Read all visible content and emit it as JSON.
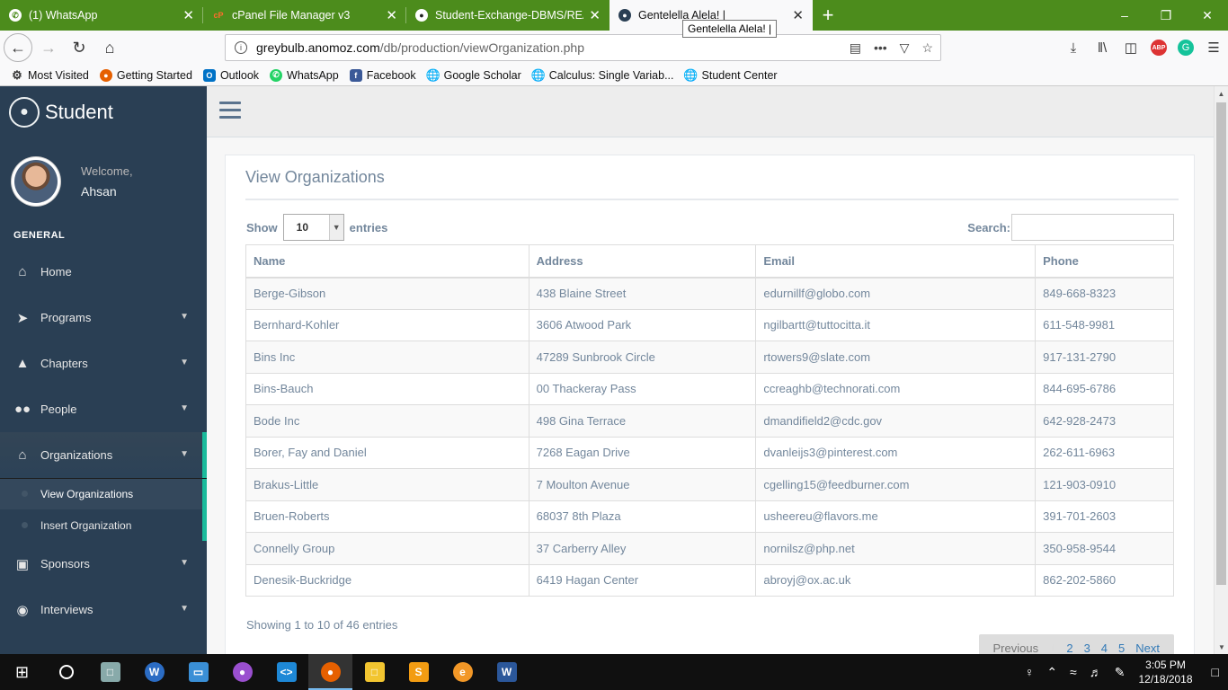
{
  "browser": {
    "tabs": [
      {
        "label": "(1) WhatsApp",
        "icon": "whatsapp-icon",
        "active": false
      },
      {
        "label": "cPanel File Manager v3",
        "icon": "cpanel-icon",
        "active": false
      },
      {
        "label": "Student-Exchange-DBMS/READ",
        "icon": "github-icon",
        "active": false
      },
      {
        "label": "Gentelella Alela! |",
        "icon": "paw-icon",
        "active": true
      }
    ],
    "tooltip": "Gentelella Alela! |",
    "url_host": "greybulb.anomoz.com",
    "url_path": "/db/production/viewOrganization.php",
    "bookmarks": [
      {
        "label": "Most Visited",
        "icon": "gear-icon"
      },
      {
        "label": "Getting Started",
        "icon": "firefox-icon"
      },
      {
        "label": "Outlook",
        "icon": "outlook-icon"
      },
      {
        "label": "WhatsApp",
        "icon": "whatsapp-icon"
      },
      {
        "label": "Facebook",
        "icon": "facebook-icon"
      },
      {
        "label": "Google Scholar",
        "icon": "globe-icon"
      },
      {
        "label": "Calculus: Single Variab...",
        "icon": "globe-icon"
      },
      {
        "label": "Student Center",
        "icon": "globe-icon"
      }
    ]
  },
  "sidebar": {
    "brand": "Student",
    "welcome": "Welcome,",
    "user": "Ahsan",
    "section": "GENERAL",
    "items": [
      {
        "label": "Home",
        "icon": "home-icon"
      },
      {
        "label": "Programs",
        "icon": "rocket-icon"
      },
      {
        "label": "Chapters",
        "icon": "graduation-cap-icon"
      },
      {
        "label": "People",
        "icon": "users-icon"
      },
      {
        "label": "Organizations",
        "icon": "bank-icon"
      },
      {
        "label": "Sponsors",
        "icon": "money-icon"
      },
      {
        "label": "Interviews",
        "icon": "comments-icon"
      }
    ],
    "submenu": [
      "View Organizations",
      "Insert Organization"
    ]
  },
  "main": {
    "title": "View Organizations",
    "show_label": "Show",
    "entries_label": "entries",
    "page_length": "10",
    "search_label": "Search:",
    "columns": [
      "Name",
      "Address",
      "Email",
      "Phone"
    ],
    "rows": [
      [
        "Berge-Gibson",
        "438 Blaine Street",
        "edurnillf@globo.com",
        "849-668-8323"
      ],
      [
        "Bernhard-Kohler",
        "3606 Atwood Park",
        "ngilbartt@tuttocitta.it",
        "611-548-9981"
      ],
      [
        "Bins Inc",
        "47289 Sunbrook Circle",
        "rtowers9@slate.com",
        "917-131-2790"
      ],
      [
        "Bins-Bauch",
        "00 Thackeray Pass",
        "ccreaghb@technorati.com",
        "844-695-6786"
      ],
      [
        "Bode Inc",
        "498 Gina Terrace",
        "dmandifield2@cdc.gov",
        "642-928-2473"
      ],
      [
        "Borer, Fay and Daniel",
        "7268 Eagan Drive",
        "dvanleijs3@pinterest.com",
        "262-611-6963"
      ],
      [
        "Brakus-Little",
        "7 Moulton Avenue",
        "cgelling15@feedburner.com",
        "121-903-0910"
      ],
      [
        "Bruen-Roberts",
        "68037 8th Plaza",
        "usheereu@flavors.me",
        "391-701-2603"
      ],
      [
        "Connelly Group",
        "37 Carberry Alley",
        "nornilsz@php.net",
        "350-958-9544"
      ],
      [
        "Denesik-Buckridge",
        "6419 Hagan Center",
        "abroyj@ox.ac.uk",
        "862-202-5860"
      ]
    ],
    "info": "Showing 1 to 10 of 46 entries",
    "pagination": {
      "previous": "Previous",
      "pages": [
        "1",
        "2",
        "3",
        "4",
        "5"
      ],
      "next": "Next"
    }
  },
  "taskbar": {
    "time": "3:05 PM",
    "date": "12/18/2018"
  },
  "colors": {
    "tabbar": "#4c8c1c",
    "sidebar": "#2a3f54",
    "accent": "#1abb9c",
    "text_muted": "#73879c"
  }
}
